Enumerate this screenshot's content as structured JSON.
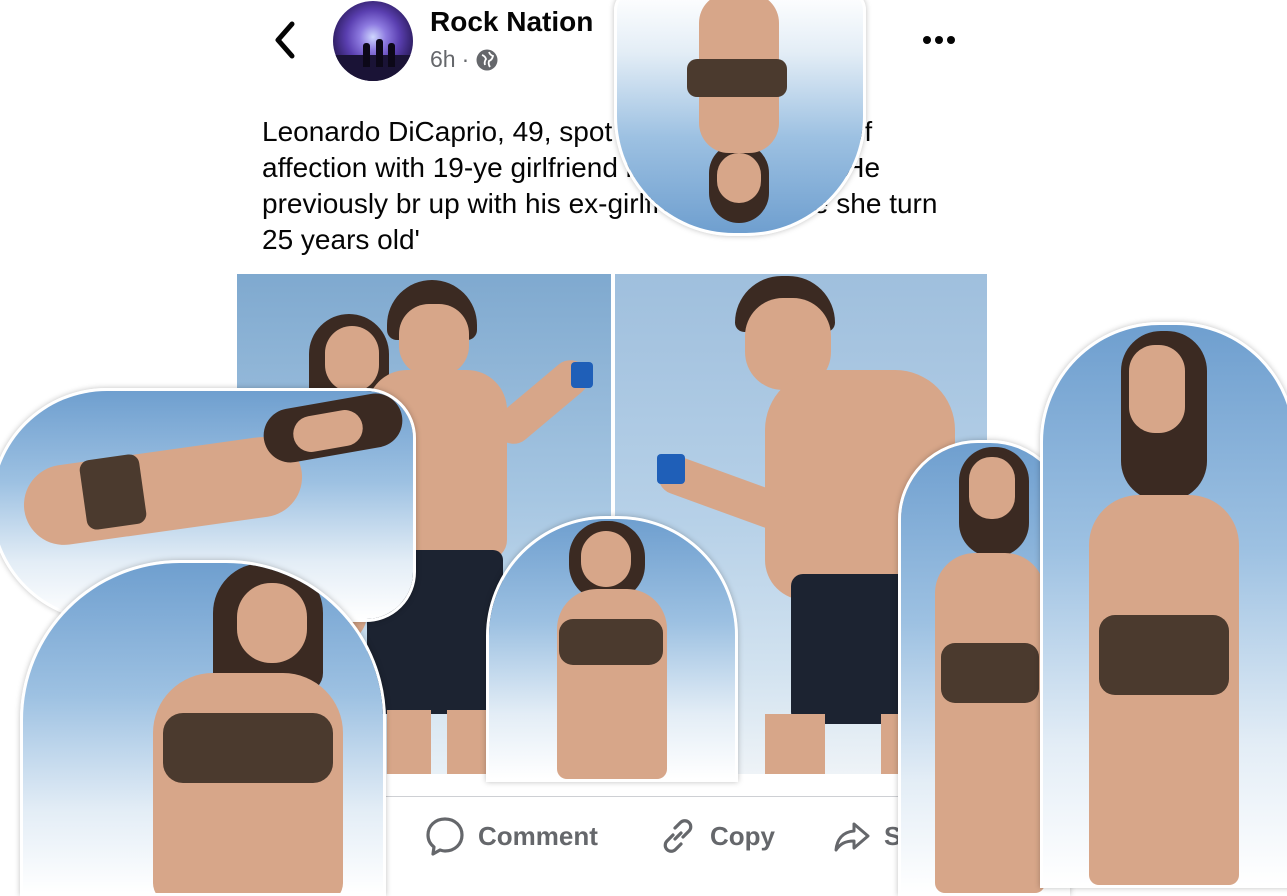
{
  "header": {
    "page_name": "Rock Nation",
    "timestamp": "6h",
    "separator": "·",
    "audience_icon": "globe-icon",
    "back_icon": "chevron-left-icon",
    "more_icon": "more-horizontal-icon"
  },
  "post": {
    "caption_parts": [
      "Leonardo DiCaprio, 49, spot",
      "g in public display of affection with 19-ye",
      "girlfriend in the Caribbean 'He previously br",
      "up with his ex-girlfriend because she turn 25 years old'"
    ],
    "photo": {
      "panels": [
        "beach-couple-left-panel",
        "beach-man-camera-right-panel"
      ]
    }
  },
  "actions": {
    "comment_label": "Comment",
    "copy_label": "Copy",
    "share_label": "S",
    "comment_icon": "comment-bubble-icon",
    "copy_icon": "link-icon",
    "share_icon": "share-arrow-icon"
  },
  "colors": {
    "text_primary": "#050505",
    "text_secondary": "#65676b",
    "divider": "#ced0d4",
    "background": "#ffffff"
  }
}
